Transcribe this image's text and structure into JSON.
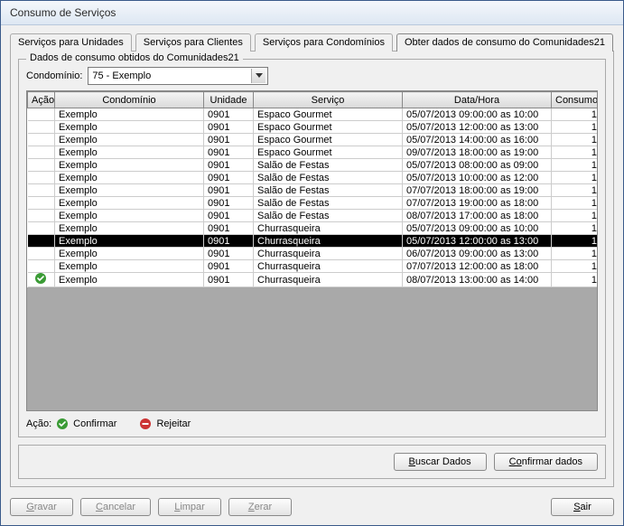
{
  "title": "Consumo de Serviços",
  "tabs": [
    {
      "label": "Serviços para Unidades",
      "active": false
    },
    {
      "label": "Serviços para Clientes",
      "active": false
    },
    {
      "label": "Serviços para Condomínios",
      "active": false
    },
    {
      "label": "Obter dados de consumo do Comunidades21",
      "active": true
    }
  ],
  "fieldset_title": "Dados de consumo obtidos do Comunidades21",
  "combo": {
    "label": "Condomínio:",
    "selected": "75 - Exemplo"
  },
  "columns": {
    "acao": "Ação",
    "condominio": "Condomínio",
    "unidade": "Unidade",
    "servico": "Serviço",
    "datahora": "Data/Hora",
    "consumo": "Consumo"
  },
  "rows": [
    {
      "acao": "",
      "condominio": "Exemplo",
      "unidade": "0901",
      "servico": "Espaco Gourmet",
      "datahora": "05/07/2013 09:00:00 as 10:00",
      "consumo": "1",
      "selected": false
    },
    {
      "acao": "",
      "condominio": "Exemplo",
      "unidade": "0901",
      "servico": "Espaco Gourmet",
      "datahora": "05/07/2013 12:00:00 as 13:00",
      "consumo": "1",
      "selected": false
    },
    {
      "acao": "",
      "condominio": "Exemplo",
      "unidade": "0901",
      "servico": "Espaco Gourmet",
      "datahora": "05/07/2013 14:00:00 as 16:00",
      "consumo": "1",
      "selected": false
    },
    {
      "acao": "",
      "condominio": "Exemplo",
      "unidade": "0901",
      "servico": "Espaco Gourmet",
      "datahora": "09/07/2013 18:00:00 as 19:00",
      "consumo": "1",
      "selected": false
    },
    {
      "acao": "",
      "condominio": "Exemplo",
      "unidade": "0901",
      "servico": "Salão de Festas",
      "datahora": "05/07/2013 08:00:00 as 09:00",
      "consumo": "1",
      "selected": false
    },
    {
      "acao": "",
      "condominio": "Exemplo",
      "unidade": "0901",
      "servico": "Salão de Festas",
      "datahora": "05/07/2013 10:00:00 as 12:00",
      "consumo": "1",
      "selected": false
    },
    {
      "acao": "",
      "condominio": "Exemplo",
      "unidade": "0901",
      "servico": "Salão de Festas",
      "datahora": "07/07/2013 18:00:00 as 19:00",
      "consumo": "1",
      "selected": false
    },
    {
      "acao": "",
      "condominio": "Exemplo",
      "unidade": "0901",
      "servico": "Salão de Festas",
      "datahora": "07/07/2013 19:00:00 as 18:00",
      "consumo": "1",
      "selected": false
    },
    {
      "acao": "",
      "condominio": "Exemplo",
      "unidade": "0901",
      "servico": "Salão de Festas",
      "datahora": "08/07/2013 17:00:00 as 18:00",
      "consumo": "1",
      "selected": false
    },
    {
      "acao": "",
      "condominio": "Exemplo",
      "unidade": "0901",
      "servico": "Churrasqueira",
      "datahora": "05/07/2013 09:00:00 as 10:00",
      "consumo": "1",
      "selected": false
    },
    {
      "acao": "",
      "condominio": "Exemplo",
      "unidade": "0901",
      "servico": "Churrasqueira",
      "datahora": "05/07/2013 12:00:00 as 13:00",
      "consumo": "1",
      "selected": true
    },
    {
      "acao": "",
      "condominio": "Exemplo",
      "unidade": "0901",
      "servico": "Churrasqueira",
      "datahora": "06/07/2013 09:00:00 as 13:00",
      "consumo": "1",
      "selected": false
    },
    {
      "acao": "",
      "condominio": "Exemplo",
      "unidade": "0901",
      "servico": "Churrasqueira",
      "datahora": "07/07/2013 12:00:00 as 18:00",
      "consumo": "1",
      "selected": false
    },
    {
      "acao": "confirm",
      "condominio": "Exemplo",
      "unidade": "0901",
      "servico": "Churrasqueira",
      "datahora": "08/07/2013 13:00:00 as 14:00",
      "consumo": "1",
      "selected": false
    }
  ],
  "legend": {
    "prefix": "Ação:",
    "confirm": "Confirmar",
    "reject": "Rejeitar"
  },
  "buttons": {
    "buscar": "Buscar Dados",
    "confirmar_dados": "Confirmar dados",
    "gravar": "Gravar",
    "cancelar": "Cancelar",
    "limpar": "Limpar",
    "zerar": "Zerar",
    "sair": "Sair"
  }
}
